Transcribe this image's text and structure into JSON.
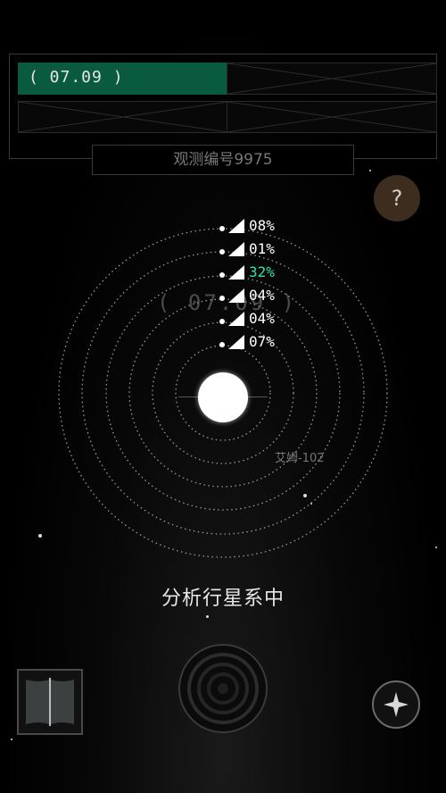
{
  "slots": {
    "active_label": "( 07.09 )"
  },
  "observation_label": "观测编号9975",
  "help_icon": "question-mark-icon",
  "help_glyph": "?",
  "ghost_label": "( 07.09 )",
  "signals": [
    {
      "pct": "08%",
      "highlight": false,
      "level": 1.0
    },
    {
      "pct": "01%",
      "highlight": false,
      "level": 1.0
    },
    {
      "pct": "32%",
      "highlight": true,
      "level": 1.0
    },
    {
      "pct": "04%",
      "highlight": false,
      "level": 1.0
    },
    {
      "pct": "04%",
      "highlight": false,
      "level": 1.0
    },
    {
      "pct": "07%",
      "highlight": false,
      "level": 1.0
    }
  ],
  "system_name": "艾姆-102",
  "status_text": "分析行星系中",
  "icons": {
    "map": "map-icon",
    "radar": "radar-icon",
    "compass": "compass-star-icon",
    "signal": "signal-strength-icon"
  },
  "colors": {
    "active_slot": "#0a5a3f",
    "highlight": "#2ee5a0",
    "help_bg": "#3c2d1f"
  }
}
